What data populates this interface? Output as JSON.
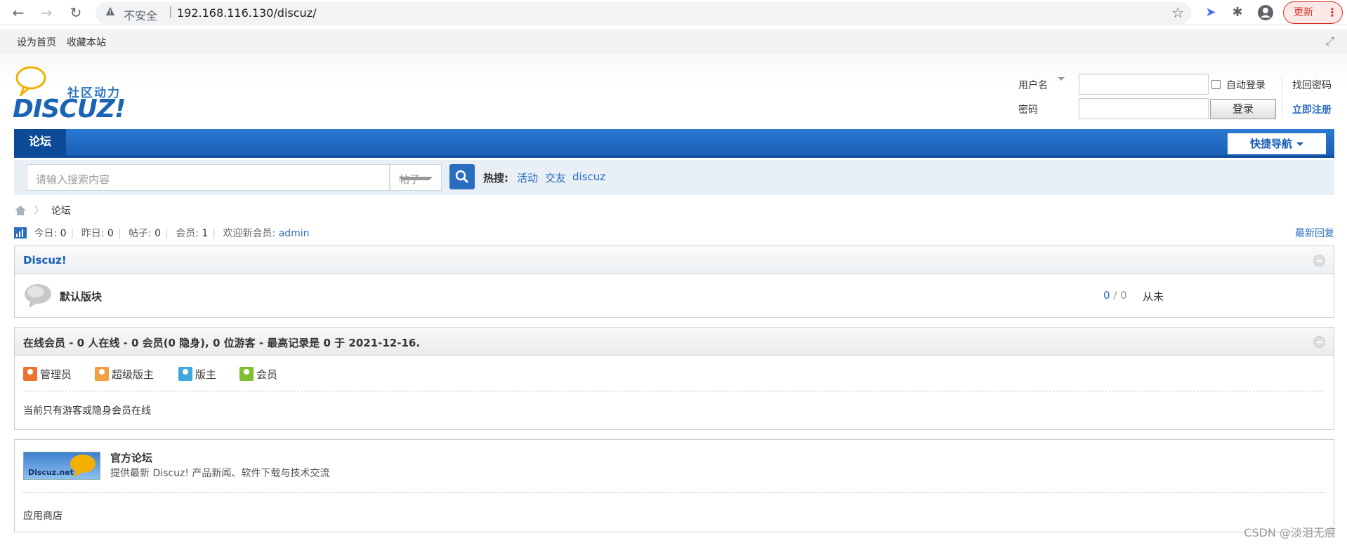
{
  "browser": {
    "insecure_label": "不安全",
    "separator": "|",
    "url": "192.168.116.130/discuz/",
    "update_label": "更新"
  },
  "toplinks": {
    "set_home": "设为首页",
    "bookmark": "收藏本站"
  },
  "logo": {
    "cn_text": "社区动力",
    "en_text": "DISCUZ!"
  },
  "login": {
    "username_label": "用户名",
    "password_label": "密码",
    "auto_login": "自动登录",
    "login_button": "登录",
    "find_password": "找回密码",
    "register": "立即注册"
  },
  "nav": {
    "forum_tab": "论坛",
    "quick_nav": "快捷导航"
  },
  "search": {
    "placeholder": "请输入搜索内容",
    "type": "帖子",
    "hot_label": "热搜:",
    "hot_words": [
      "活动",
      "交友",
      "discuz"
    ]
  },
  "breadcrumb": {
    "current": "论坛"
  },
  "stats": {
    "today_label": "今日:",
    "today": "0",
    "yesterday_label": "昨日:",
    "yesterday": "0",
    "posts_label": "帖子:",
    "posts": "0",
    "members_label": "会员:",
    "members": "1",
    "welcome_label": "欢迎新会员:",
    "new_member": "admin",
    "latest_reply": "最新回复"
  },
  "category": {
    "title": "Discuz!",
    "forums": [
      {
        "name": "默认版块",
        "threads": "0",
        "slash": "/",
        "posts": "0",
        "last": "从未"
      }
    ]
  },
  "online": {
    "title": "在线会员 - 0 人在线 - 0 会员(0 隐身), 0 位游客 - 最高记录是 0 于 2021-12-16.",
    "legend": [
      {
        "label": "管理员",
        "color": "#f07030"
      },
      {
        "label": "超级版主",
        "color": "#f0a040"
      },
      {
        "label": "版主",
        "color": "#40a8e0"
      },
      {
        "label": "会员",
        "color": "#80c030"
      }
    ],
    "message": "当前只有游客或隐身会员在线"
  },
  "links": {
    "name": "官方论坛",
    "description": "提供最新 Discuz! 产品新闻、软件下载与技术交流",
    "badge_text": "Discuz.net",
    "app_store": "应用商店"
  },
  "watermark": "CSDN @淡泪无痕"
}
